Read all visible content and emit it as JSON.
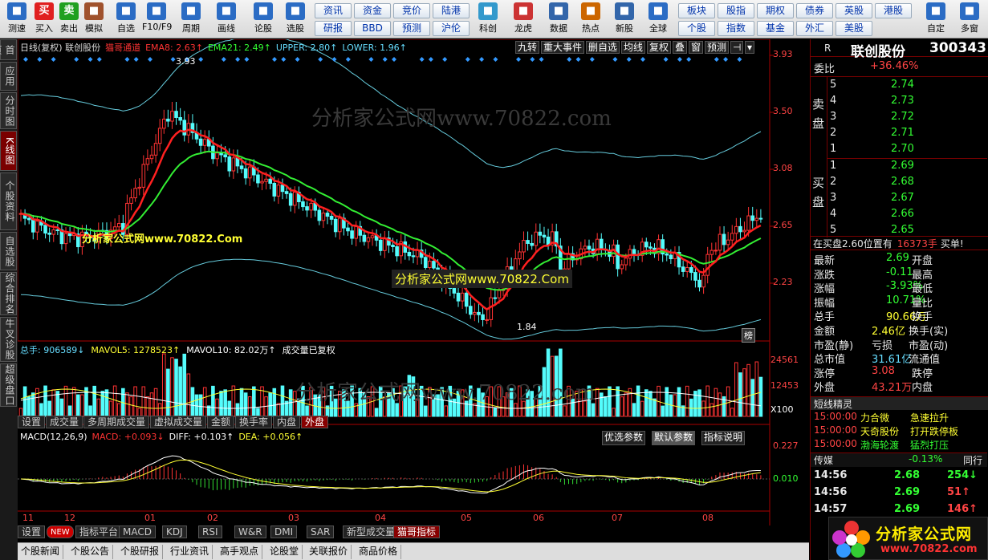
{
  "toolbar": {
    "left": [
      {
        "label": "测速",
        "icon": "speed-icon",
        "color": "#2b6cc4"
      },
      {
        "label": "买入",
        "icon": "buy-icon",
        "color": "#e02020",
        "glyph": "买"
      },
      {
        "label": "卖出",
        "icon": "sell-icon",
        "color": "#20a020",
        "glyph": "卖"
      },
      {
        "label": "模拟",
        "icon": "hammer-icon",
        "color": "#a0522d"
      },
      {
        "label": "自选",
        "icon": "star-icon",
        "color": "#2b6cc4"
      },
      {
        "label": "F10/F9",
        "icon": "f10-icon",
        "color": "#2b6cc4"
      },
      {
        "label": "周期",
        "icon": "clock-icon",
        "color": "#2b6cc4"
      },
      {
        "label": "画线",
        "icon": "pen-icon",
        "color": "#2b6cc4"
      },
      {
        "label": "论股",
        "icon": "discuss-icon",
        "color": "#2b6cc4"
      },
      {
        "label": "选股",
        "icon": "select-stock-icon",
        "color": "#2b6cc4"
      }
    ],
    "grid": [
      [
        "资讯",
        "资金",
        "竞价",
        "陆港"
      ],
      [
        "研报",
        "BBD",
        "预测",
        "沪伦"
      ]
    ],
    "mid": [
      {
        "label": "科创",
        "icon": "chart-icon",
        "color": "#3399cc"
      },
      {
        "label": "龙虎",
        "icon": "dragon-icon",
        "color": "#cc3333"
      },
      {
        "label": "数据",
        "icon": "pe-icon",
        "color": "#3366aa"
      },
      {
        "label": "热点",
        "icon": "hot-icon",
        "color": "#cc6600"
      },
      {
        "label": "新股",
        "icon": "ipo-icon",
        "color": "#3366aa"
      },
      {
        "label": "全球",
        "icon": "globe-icon",
        "color": "#2b6cc4"
      }
    ],
    "grid2": [
      [
        "板块",
        "股指",
        "期权",
        "债券",
        "英股",
        "港股"
      ],
      [
        "个股",
        "指数",
        "基金",
        "外汇",
        "美股"
      ]
    ],
    "right": [
      {
        "label": "自定",
        "icon": "custom-icon",
        "color": "#2b6cc4"
      },
      {
        "label": "多窗",
        "icon": "multi-window-icon",
        "color": "#2b6cc4"
      }
    ]
  },
  "lefttabs": [
    "首页",
    "应用",
    "分时图",
    "K线图",
    "个股资料",
    "自选股",
    "综合排名",
    "牛叉诊股",
    "超级盘口"
  ],
  "chart": {
    "header": "日线(复权)  联创股份",
    "indicator": "猫哥通道",
    "legend": [
      {
        "t": "EMA8: 2.63↑",
        "c": "#ff3333"
      },
      {
        "t": "EMA21: 2.49↑",
        "c": "#33ff33"
      },
      {
        "t": "UPPER: 2.80↑",
        "c": "#66ddff"
      },
      {
        "t": "LOWER: 1.96↑",
        "c": "#66ddff"
      }
    ],
    "top_tabs": [
      "九转",
      "重大事件",
      "删自选",
      "均线",
      "复权",
      "叠",
      "窗",
      "预测"
    ],
    "price_ticks": [
      "3.93",
      "3.50",
      "3.08",
      "2.65",
      "2.23"
    ],
    "high_label": "3.93",
    "low_label": "1.84",
    "vol_legend": [
      {
        "t": "总手: 906589↓",
        "c": "#66ddff"
      },
      {
        "t": "MAVOL5: 1278523↑",
        "c": "#ffff33"
      },
      {
        "t": "MAVOL10: 82.02万↑",
        "c": "#fff"
      },
      {
        "t": "成交量已复权",
        "c": "#fff"
      }
    ],
    "vol_ticks": [
      "24561",
      "12453",
      "X100"
    ],
    "subtabs": [
      "设置",
      "成交量",
      "多周期成交量",
      "虚拟成交量",
      "金额",
      "换手率",
      "内盘",
      "外盘"
    ],
    "macd_legend": [
      {
        "t": "MACD(12,26,9)",
        "c": "#fff"
      },
      {
        "t": "MACD: +0.093↓",
        "c": "#ff3333"
      },
      {
        "t": "DIFF: +0.103↑",
        "c": "#fff"
      },
      {
        "t": "DEA: +0.056↑",
        "c": "#ffff33"
      }
    ],
    "macd_buttons": [
      "优选参数",
      "默认参数",
      "指标说明"
    ],
    "macd_ticks": [
      "0.227",
      "0.010"
    ],
    "months": [
      "11",
      "12",
      "01",
      "02",
      "03",
      "04",
      "05",
      "06",
      "07",
      "08"
    ],
    "bottomtabs": [
      "设置",
      "NEW",
      "指标平台",
      "MACD",
      "KDJ",
      "RSI",
      "W&R",
      "DMI",
      "SAR",
      "新型成交量",
      "猫哥指标"
    ],
    "watermark": "分析家公式网www.70822.com",
    "watermark2": "分析家公式网www.70822.Com",
    "badge": "榜"
  },
  "quote": {
    "name": "联创股份",
    "code": "300343",
    "r": "R",
    "weibi": {
      "label": "委比",
      "value": "+36.46%"
    },
    "sell": [
      {
        "n": "5",
        "p": "2.74"
      },
      {
        "n": "4",
        "p": "2.73"
      },
      {
        "n": "3",
        "p": "2.72"
      },
      {
        "n": "2",
        "p": "2.71"
      },
      {
        "n": "1",
        "p": "2.70"
      }
    ],
    "buy": [
      {
        "n": "1",
        "p": "2.69"
      },
      {
        "n": "2",
        "p": "2.68"
      },
      {
        "n": "3",
        "p": "2.67"
      },
      {
        "n": "4",
        "p": "2.66"
      },
      {
        "n": "5",
        "p": "2.65"
      }
    ],
    "sell_label": "卖盘",
    "buy_label": "买盘",
    "notice": [
      "在买盘2.60位置有",
      "16373手",
      "买单!"
    ],
    "stats": [
      [
        "最新",
        "2.69",
        "开盘",
        ""
      ],
      [
        "涨跌",
        "-0.11",
        "最高",
        ""
      ],
      [
        "涨幅",
        "-3.93%",
        "最低",
        ""
      ],
      [
        "振幅",
        "10.71%",
        "量比",
        ""
      ],
      [
        "总手",
        "90.66万",
        "换手",
        ""
      ],
      [
        "金额",
        "2.46亿",
        "换手(实)",
        ""
      ],
      [
        "市盈(静)",
        "亏损",
        "市盈(动)",
        ""
      ],
      [
        "总市值",
        "31.61亿",
        "流通值",
        ""
      ],
      [
        "涨停",
        "3.08",
        "跌停",
        ""
      ],
      [
        "外盘",
        "43.21万",
        "内盘",
        ""
      ]
    ],
    "jingling": "短线精灵",
    "alerts": [
      [
        "15:00:00",
        "力合微",
        "急速拉升"
      ],
      [
        "15:00:00",
        "天奇股份",
        "打开跌停板"
      ],
      [
        "15:00:00",
        "渤海轮渡",
        "猛烈打压"
      ]
    ],
    "sector": [
      "传媒",
      "-0.13%",
      "同行"
    ],
    "ticks": [
      [
        "14:56",
        "2.68",
        "254"
      ],
      [
        "14:56",
        "2.69",
        "51"
      ],
      [
        "14:57",
        "2.69",
        "146"
      ]
    ]
  },
  "newsbar": [
    "个股新闻",
    "个股公告",
    "个股研报",
    "行业资讯",
    "高手观点",
    "论股堂",
    "关联报价",
    "商品价格"
  ],
  "logo": "分析家公式网",
  "logo_url": "www.70822.com"
}
